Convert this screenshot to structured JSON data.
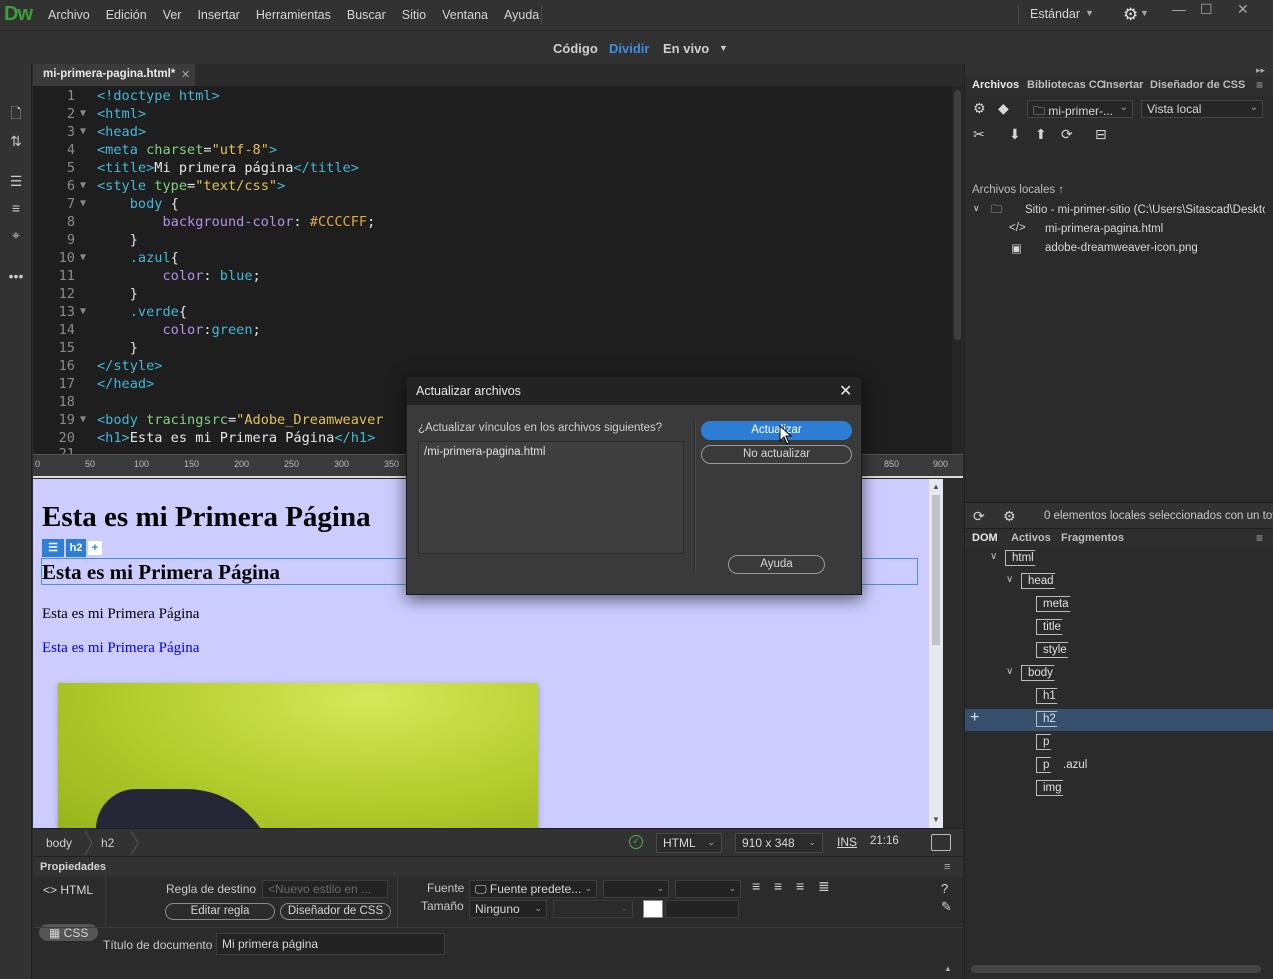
{
  "app": {
    "logo": "Dw"
  },
  "menu": [
    "Archivo",
    "Edición",
    "Ver",
    "Insertar",
    "Herramientas",
    "Buscar",
    "Sitio",
    "Ventana",
    "Ayuda"
  ],
  "workspace": "Estándar",
  "views": {
    "code": "Código",
    "split": "Dividir",
    "live": "En vivo"
  },
  "document_tab": "mi-primera-pagina.html*",
  "code_lines": [
    {
      "n": "1",
      "fold": ""
    },
    {
      "n": "2",
      "fold": "▼"
    },
    {
      "n": "3",
      "fold": "▼"
    },
    {
      "n": "4",
      "fold": ""
    },
    {
      "n": "5",
      "fold": ""
    },
    {
      "n": "6",
      "fold": "▼"
    },
    {
      "n": "7",
      "fold": "▼"
    },
    {
      "n": "8",
      "fold": ""
    },
    {
      "n": "9",
      "fold": ""
    },
    {
      "n": "10",
      "fold": "▼"
    },
    {
      "n": "11",
      "fold": ""
    },
    {
      "n": "12",
      "fold": ""
    },
    {
      "n": "13",
      "fold": "▼"
    },
    {
      "n": "14",
      "fold": ""
    },
    {
      "n": "15",
      "fold": ""
    },
    {
      "n": "16",
      "fold": ""
    },
    {
      "n": "17",
      "fold": ""
    },
    {
      "n": "18",
      "fold": ""
    },
    {
      "n": "19",
      "fold": "▼"
    },
    {
      "n": "20",
      "fold": ""
    },
    {
      "n": "21",
      "fold": ""
    }
  ],
  "code": {
    "l1": "<!doctype html>",
    "l2": "<html>",
    "l3": "<head>",
    "l4_tag": "<meta",
    "l4_attr": " charset",
    "l4_eq": "=",
    "l4_str": "\"utf-8\"",
    "l4_end": ">",
    "l5_open": "<title>",
    "l5_text": "Mi primera página",
    "l5_close": "</title>",
    "l6_tag": "<style",
    "l6_attr": " type",
    "l6_eq": "=",
    "l6_str": "\"text/css\"",
    "l6_end": ">",
    "l7_sel": "body",
    "l7_brace": " {",
    "l8_prop": "background-color",
    "l8_colon": ": ",
    "l8_val": "#CCCCFF",
    "l8_semi": ";",
    "l9": "}",
    "l10_sel": ".azul",
    "l10_brace": "{",
    "l11_prop": "color",
    "l11_colon": ": ",
    "l11_val": "blue",
    "l11_semi": ";",
    "l12": "}",
    "l13_sel": ".verde",
    "l13_brace": "{",
    "l14_prop": "color",
    "l14_colon": ":",
    "l14_val": "green",
    "l14_semi": ";",
    "l15": "}",
    "l16": "</style>",
    "l17": "</head>",
    "l19_tag": "<body",
    "l19_attr": " tracingsrc",
    "l19_eq": "=",
    "l19_str": "\"Adobe_Dreamweaver",
    "l20_open": "<h1>",
    "l20_text": "Esta es mi Primera Página",
    "l20_close": "</h1>"
  },
  "ruler_ticks": [
    "0",
    "50",
    "100",
    "150",
    "200",
    "250",
    "300",
    "350",
    "850",
    "900"
  ],
  "live": {
    "h1": "Esta es mi Primera Página",
    "h2": "Esta es mi Primera Página",
    "hud_tag": "h2",
    "hud_plus": "+",
    "p": "Esta es mi Primera Página",
    "p_azul": "Esta es mi Primera Página"
  },
  "status": {
    "breadcrumbs": [
      "body",
      "h2"
    ],
    "doctype": "HTML",
    "size": "910 x 348",
    "ins": "INS",
    "position": "21:16"
  },
  "properties": {
    "title": "Propiedades",
    "html_label": "HTML",
    "css_label": "CSS",
    "target_rule_label": "Regla de destino",
    "target_rule_value": "<Nuevo estilo en ...",
    "edit_rule": "Editar regla",
    "css_designer": "Diseñador de CSS",
    "font_label": "Fuente",
    "font_value": "Fuente predete...",
    "size_label": "Tamaño",
    "size_value": "Ninguno",
    "doc_title_label": "Título de documento",
    "doc_title_value": "Mi primera página"
  },
  "files_panel": {
    "tabs": [
      "Archivos",
      "Bibliotecas CC",
      "Insertar",
      "Diseñador de CSS"
    ],
    "site_select": "mi-primer-...",
    "view_select": "Vista local",
    "tree_label": "Archivos locales ↑",
    "site_root": "Sitio - mi-primer-sitio (C:\\Users\\Sitascad\\Deskto...",
    "files": [
      "mi-primera-pagina.html",
      "adobe-dreamweaver-icon.png"
    ],
    "footer": "0 elementos locales seleccionados con un tot..."
  },
  "dom_panel": {
    "tabs": [
      "DOM",
      "Activos",
      "Fragmentos"
    ],
    "nodes": [
      {
        "tag": "html",
        "class": ""
      },
      {
        "tag": "head",
        "class": ""
      },
      {
        "tag": "meta",
        "class": ""
      },
      {
        "tag": "title",
        "class": ""
      },
      {
        "tag": "style",
        "class": ""
      },
      {
        "tag": "body",
        "class": ""
      },
      {
        "tag": "h1",
        "class": ""
      },
      {
        "tag": "h2",
        "class": ""
      },
      {
        "tag": "p",
        "class": ""
      },
      {
        "tag": "p",
        "class": ".azul"
      },
      {
        "tag": "img",
        "class": ""
      }
    ]
  },
  "dialog": {
    "title": "Actualizar archivos",
    "close": "✕",
    "question": "¿Actualizar vínculos en los archivos siguientes?",
    "file": "/mi-primera-pagina.html",
    "update": "Actualizar",
    "no_update": "No actualizar",
    "help": "Ayuda"
  },
  "colors": {
    "accent": "#2d7fd6",
    "live_bg": "#ccccff",
    "brand": "#3c9d3a"
  }
}
